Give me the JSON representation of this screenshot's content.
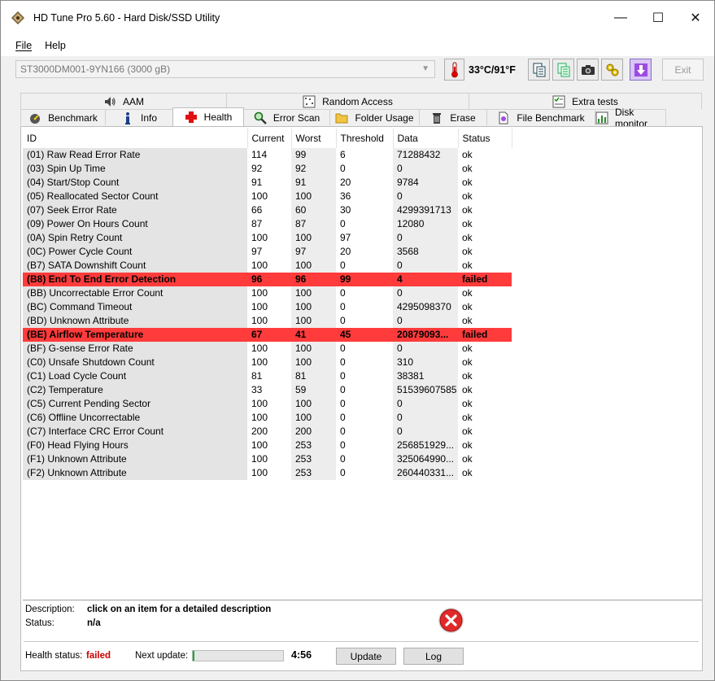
{
  "window": {
    "title": "HD Tune Pro 5.60 - Hard Disk/SSD Utility",
    "minimize": "—",
    "maximize": "☐",
    "close": "✕"
  },
  "menu": [
    "File",
    "Help"
  ],
  "toolbar": {
    "drive": "ST3000DM001-9YN166 (3000 gB)",
    "temperature": "33°C/91°F",
    "exit_label": "Exit"
  },
  "tabs_top": [
    "AAM",
    "Random Access",
    "Extra tests"
  ],
  "tabs_bottom": [
    "Benchmark",
    "Info",
    "Health",
    "Error Scan",
    "Folder Usage",
    "Erase",
    "File Benchmark",
    "Disk monitor"
  ],
  "active_tab": "Health",
  "smart": {
    "columns": [
      "ID",
      "Current",
      "Worst",
      "Threshold",
      "Data",
      "Status"
    ],
    "rows": [
      {
        "id": "(01) Raw Read Error Rate",
        "current": "114",
        "worst": "99",
        "threshold": "6",
        "data": "71288432",
        "status": "ok"
      },
      {
        "id": "(03) Spin Up Time",
        "current": "92",
        "worst": "92",
        "threshold": "0",
        "data": "0",
        "status": "ok"
      },
      {
        "id": "(04) Start/Stop Count",
        "current": "91",
        "worst": "91",
        "threshold": "20",
        "data": "9784",
        "status": "ok"
      },
      {
        "id": "(05) Reallocated Sector Count",
        "current": "100",
        "worst": "100",
        "threshold": "36",
        "data": "0",
        "status": "ok"
      },
      {
        "id": "(07) Seek Error Rate",
        "current": "66",
        "worst": "60",
        "threshold": "30",
        "data": "4299391713",
        "status": "ok"
      },
      {
        "id": "(09) Power On Hours Count",
        "current": "87",
        "worst": "87",
        "threshold": "0",
        "data": "12080",
        "status": "ok"
      },
      {
        "id": "(0A) Spin Retry Count",
        "current": "100",
        "worst": "100",
        "threshold": "97",
        "data": "0",
        "status": "ok"
      },
      {
        "id": "(0C) Power Cycle Count",
        "current": "97",
        "worst": "97",
        "threshold": "20",
        "data": "3568",
        "status": "ok"
      },
      {
        "id": "(B7) SATA Downshift Count",
        "current": "100",
        "worst": "100",
        "threshold": "0",
        "data": "0",
        "status": "ok"
      },
      {
        "id": "(B8) End To End Error Detection",
        "current": "96",
        "worst": "96",
        "threshold": "99",
        "data": "4",
        "status": "failed"
      },
      {
        "id": "(BB) Uncorrectable Error Count",
        "current": "100",
        "worst": "100",
        "threshold": "0",
        "data": "0",
        "status": "ok"
      },
      {
        "id": "(BC) Command Timeout",
        "current": "100",
        "worst": "100",
        "threshold": "0",
        "data": "4295098370",
        "status": "ok"
      },
      {
        "id": "(BD) Unknown Attribute",
        "current": "100",
        "worst": "100",
        "threshold": "0",
        "data": "0",
        "status": "ok"
      },
      {
        "id": "(BE) Airflow Temperature",
        "current": "67",
        "worst": "41",
        "threshold": "45",
        "data": "20879093...",
        "status": "failed"
      },
      {
        "id": "(BF) G-sense Error Rate",
        "current": "100",
        "worst": "100",
        "threshold": "0",
        "data": "0",
        "status": "ok"
      },
      {
        "id": "(C0) Unsafe Shutdown Count",
        "current": "100",
        "worst": "100",
        "threshold": "0",
        "data": "310",
        "status": "ok"
      },
      {
        "id": "(C1) Load Cycle Count",
        "current": "81",
        "worst": "81",
        "threshold": "0",
        "data": "38381",
        "status": "ok"
      },
      {
        "id": "(C2) Temperature",
        "current": "33",
        "worst": "59",
        "threshold": "0",
        "data": "51539607585",
        "status": "ok"
      },
      {
        "id": "(C5) Current Pending Sector",
        "current": "100",
        "worst": "100",
        "threshold": "0",
        "data": "0",
        "status": "ok"
      },
      {
        "id": "(C6) Offline Uncorrectable",
        "current": "100",
        "worst": "100",
        "threshold": "0",
        "data": "0",
        "status": "ok"
      },
      {
        "id": "(C7) Interface CRC Error Count",
        "current": "200",
        "worst": "200",
        "threshold": "0",
        "data": "0",
        "status": "ok"
      },
      {
        "id": "(F0) Head Flying Hours",
        "current": "100",
        "worst": "253",
        "threshold": "0",
        "data": "256851929...",
        "status": "ok"
      },
      {
        "id": "(F1) Unknown Attribute",
        "current": "100",
        "worst": "253",
        "threshold": "0",
        "data": "325064990...",
        "status": "ok"
      },
      {
        "id": "(F2) Unknown Attribute",
        "current": "100",
        "worst": "253",
        "threshold": "0",
        "data": "260440331...",
        "status": "ok"
      }
    ]
  },
  "details": {
    "description_label": "Description:",
    "description_value": "click on an item for a detailed description",
    "status_label": "Status:",
    "status_value": "n/a"
  },
  "footer": {
    "health_label": "Health status:",
    "health_value": "failed",
    "next_update_label": "Next update:",
    "progress_fraction": 0.02,
    "countdown": "4:56",
    "update_label": "Update",
    "log_label": "Log"
  },
  "colors": {
    "failed_row": "#ff3b3b",
    "health_failed_text": "#cc0000",
    "progress_fill": "#06b025"
  }
}
